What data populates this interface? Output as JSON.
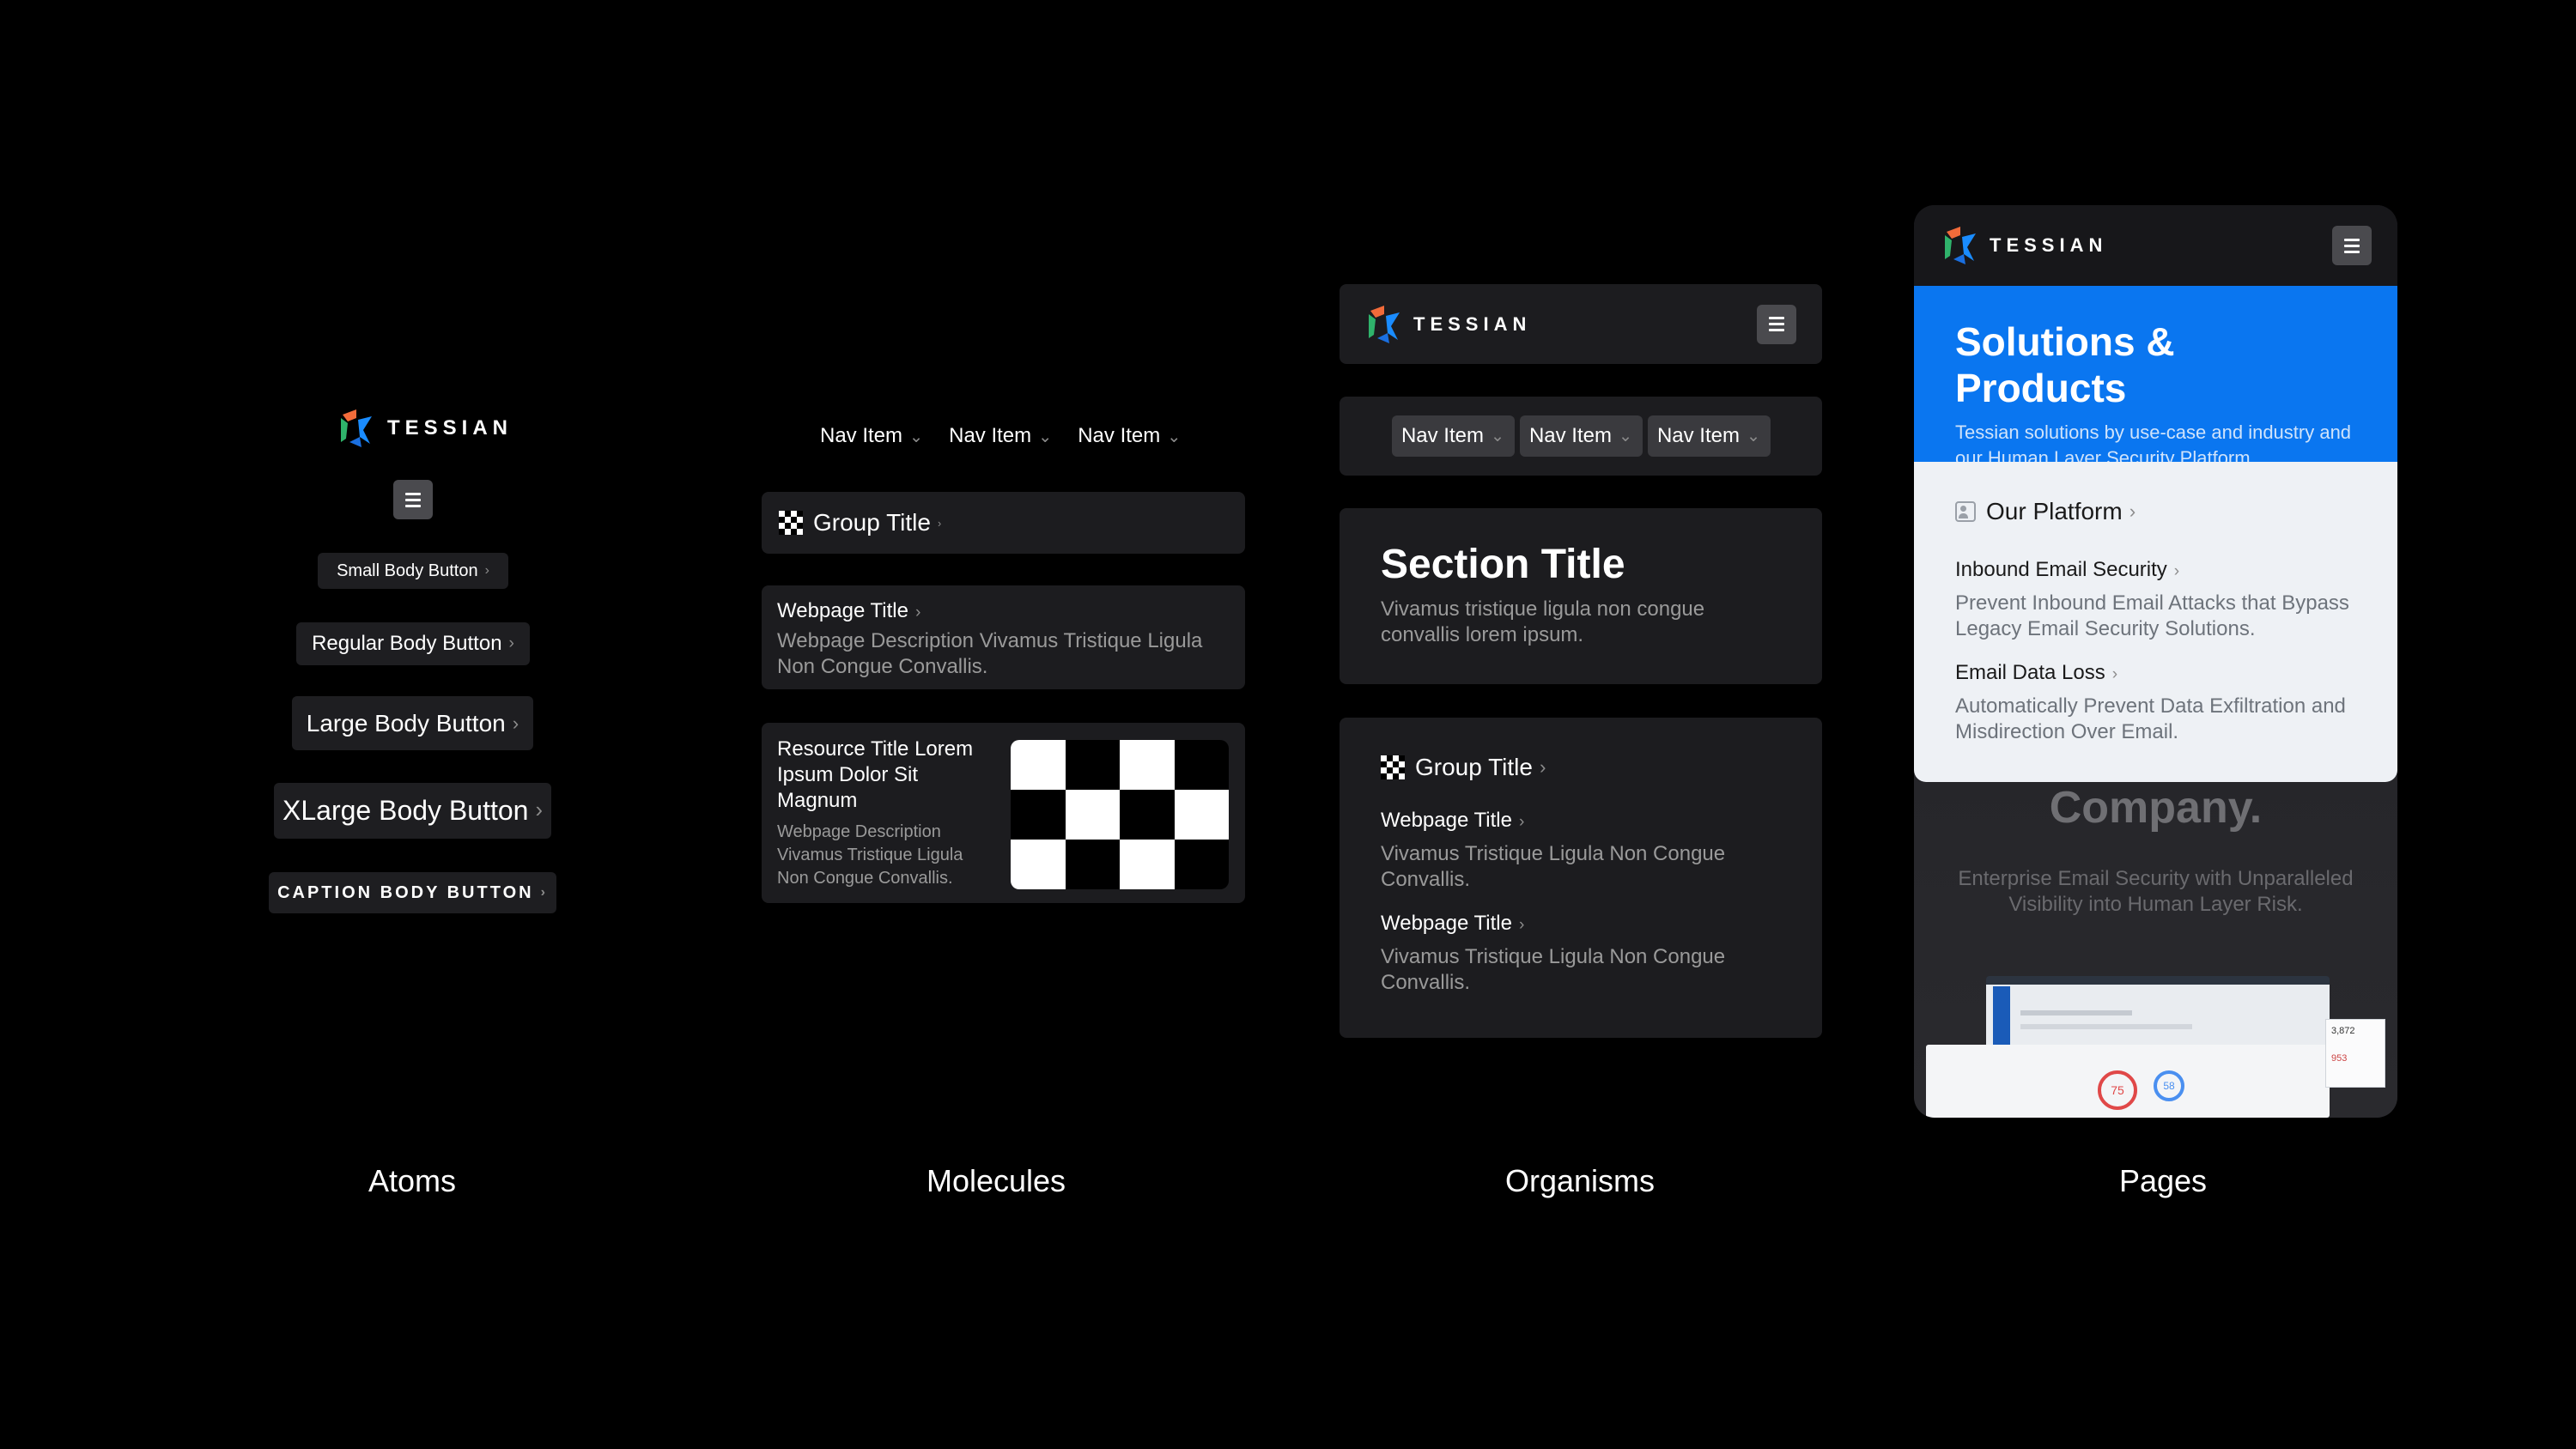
{
  "logo": {
    "text": "TESSIAN"
  },
  "atoms": {
    "buttons": {
      "small": "Small Body Button",
      "regular": "Regular Body Button",
      "large": "Large Body Button",
      "xlarge": "XLarge Body Button",
      "caption": "CAPTION BODY BUTTON"
    },
    "label": "Atoms"
  },
  "molecules": {
    "nav_items": [
      "Nav Item",
      "Nav Item",
      "Nav Item"
    ],
    "group_title": "Group Title",
    "webpage_title": "Webpage Title",
    "webpage_description": "Webpage Description Vivamus Tristique Ligula Non Congue Convallis.",
    "resource_title": "Resource Title Lorem Ipsum Dolor Sit Magnum",
    "resource_description": "Webpage Description Vivamus Tristique Ligula Non Congue Convallis.",
    "label": "Molecules"
  },
  "organisms": {
    "nav_items": [
      "Nav Item",
      "Nav Item",
      "Nav Item"
    ],
    "section_title": "Section Title",
    "section_description": "Vivamus tristique ligula non congue convallis lorem ipsum.",
    "group_title": "Group Title",
    "links": [
      {
        "title": "Webpage Title",
        "description": "Vivamus Tristique Ligula Non Congue Convallis."
      },
      {
        "title": "Webpage Title",
        "description": "Vivamus Tristique Ligula Non Congue Convallis."
      }
    ],
    "label": "Organisms"
  },
  "pages": {
    "hero_title": "Solutions & Products",
    "hero_subtitle": "Tessian solutions by use-case and industry and our Human Layer Security Platform.",
    "platform_title": "Our Platform",
    "items": [
      {
        "title": "Inbound Email Security",
        "description": "Prevent Inbound Email Attacks that Bypass Legacy Email Security Solutions."
      },
      {
        "title": "Email Data Loss",
        "description": "Automatically Prevent Data Exfiltration and Misdirection Over Email."
      }
    ],
    "bg_heading": "Company.",
    "bg_text": "Enterprise Email Security with Unparalleled Visibility into Human Layer Risk.",
    "dashboard": {
      "stat_a": "75",
      "stat_b": "58",
      "stat_c": "3,872",
      "stat_d": "953"
    },
    "label": "Pages"
  },
  "colors": {
    "accent_blue": "#0a76f0",
    "panel": "#1c1c1f",
    "light_panel": "#eef1f5"
  }
}
